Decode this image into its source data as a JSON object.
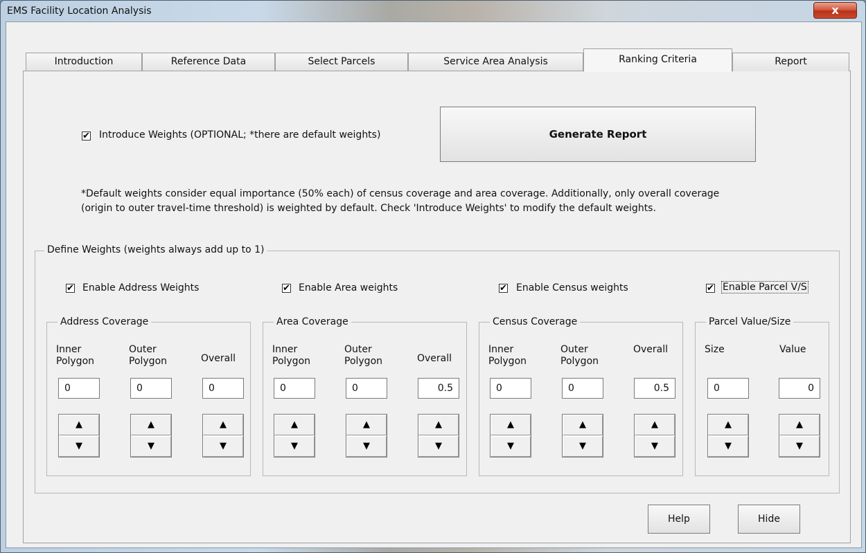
{
  "window": {
    "title": "EMS Facility Location Analysis",
    "close_glyph": "x"
  },
  "tabs": [
    {
      "label": "Introduction"
    },
    {
      "label": "Reference Data"
    },
    {
      "label": "Select Parcels"
    },
    {
      "label": "Service Area Analysis"
    },
    {
      "label": "Ranking Criteria",
      "active": true
    },
    {
      "label": "Report"
    }
  ],
  "main": {
    "introduce_weights": {
      "label": "Introduce Weights (OPTIONAL; *there are default weights)",
      "checked": true
    },
    "generate_report_label": "Generate Report",
    "note_line1": "*Default weights consider equal importance (50% each) of census coverage and area coverage. Additionally, only overall coverage",
    "note_line2": "(origin to outer travel-time threshold) is weighted by default. Check 'Introduce Weights' to modify the default weights."
  },
  "define_weights": {
    "legend": "Define Weights (weights always add up to 1)",
    "enable": [
      {
        "label": "Enable Address Weights",
        "checked": true
      },
      {
        "label": "Enable Area weights",
        "checked": true
      },
      {
        "label": "Enable Census weights",
        "checked": true
      },
      {
        "label": "Enable Parcel  V/S",
        "checked": true
      }
    ],
    "groups": {
      "address": {
        "legend": "Address Coverage",
        "cols": [
          {
            "label1": "Inner",
            "label2": "Polygon",
            "value": "0"
          },
          {
            "label1": "Outer",
            "label2": "Polygon",
            "value": "0"
          },
          {
            "label1": "Overall",
            "label2": "",
            "value": "0"
          }
        ]
      },
      "area": {
        "legend": "Area Coverage",
        "cols": [
          {
            "label1": "Inner",
            "label2": "Polygon",
            "value": "0"
          },
          {
            "label1": "Outer",
            "label2": "Polygon",
            "value": "0"
          },
          {
            "label1": "Overall",
            "label2": "",
            "value": "0.5"
          }
        ]
      },
      "census": {
        "legend": "Census Coverage",
        "cols": [
          {
            "label1": "Inner",
            "label2": "Polygon",
            "value": "0"
          },
          {
            "label1": "Outer",
            "label2": "Polygon",
            "value": "0"
          },
          {
            "label1": "Overall",
            "label2": "",
            "value": "0.5"
          }
        ]
      },
      "parcel": {
        "legend": "Parcel Value/Size",
        "cols": [
          {
            "label1": "Size",
            "label2": "",
            "value": "0"
          },
          {
            "label1": "Value",
            "label2": "",
            "value": "0"
          }
        ]
      }
    }
  },
  "footer": {
    "help_label": "Help",
    "hide_label": "Hide"
  },
  "icons": {
    "checkmark": "✔",
    "up_arrow": "▲",
    "down_arrow": "▼"
  }
}
